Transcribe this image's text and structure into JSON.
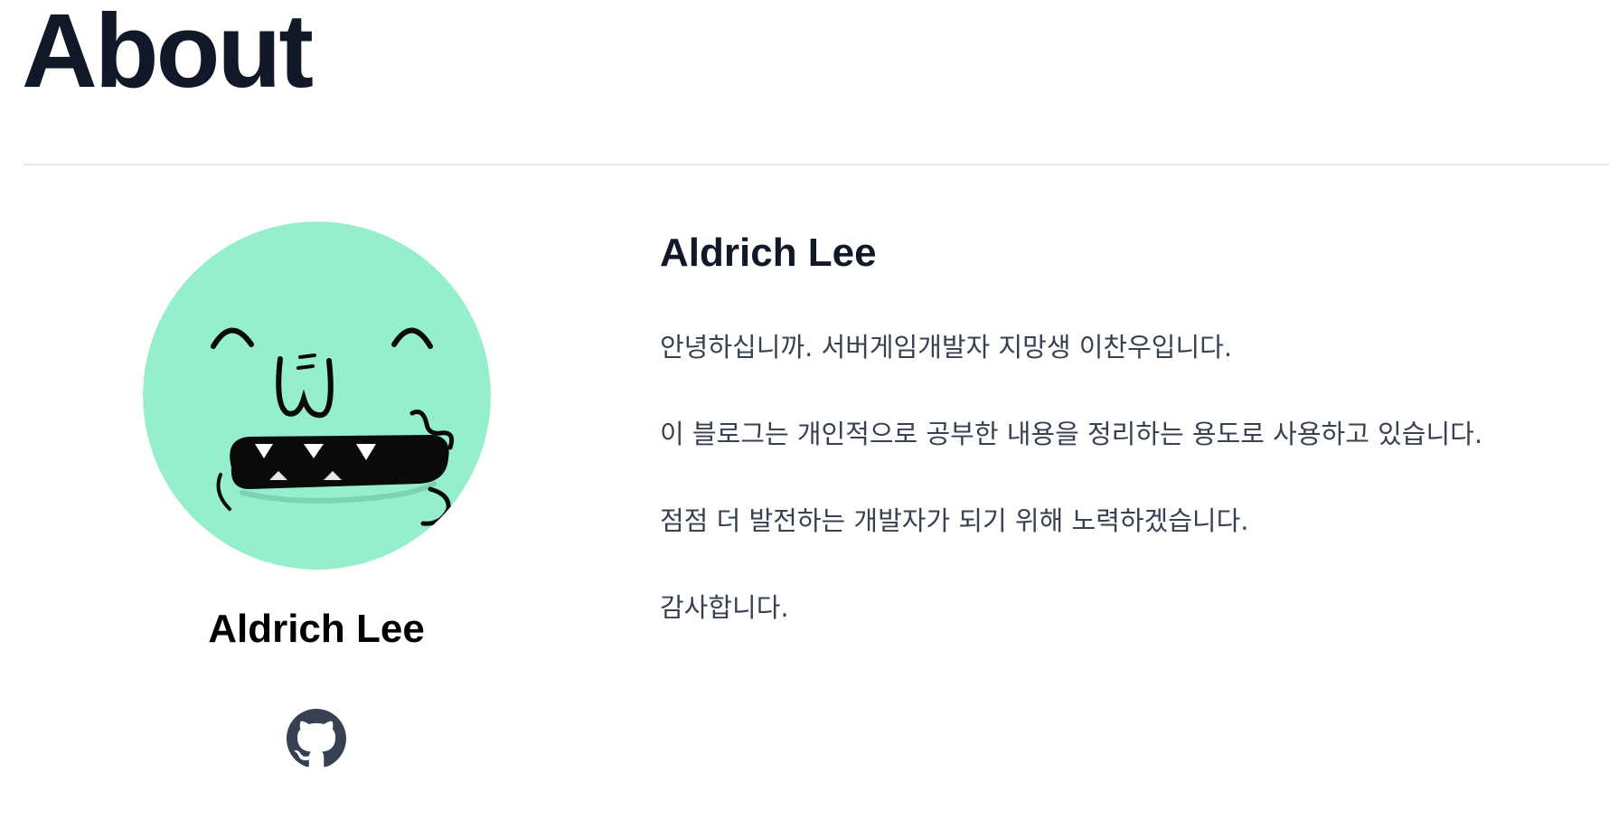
{
  "page": {
    "title": "About"
  },
  "profile": {
    "name": "Aldrich Lee",
    "avatar_icon": "monster-face-avatar",
    "avatar_color": "#95efcc",
    "social": [
      {
        "icon": "github-icon"
      }
    ]
  },
  "about": {
    "heading": "Aldrich Lee",
    "paragraphs": [
      "안녕하십니까. 서버게임개발자 지망생 이찬우입니다.",
      "이 블로그는 개인적으로 공부한 내용을 정리하는 용도로 사용하고 있습니다.",
      "점점 더 발전하는 개발자가 되기 위해 노력하겠습니다.",
      "감사합니다."
    ]
  },
  "colors": {
    "text_primary": "#111827",
    "text_body": "#374151",
    "divider": "#e5e7eb",
    "avatar_bg": "#95efcc"
  }
}
